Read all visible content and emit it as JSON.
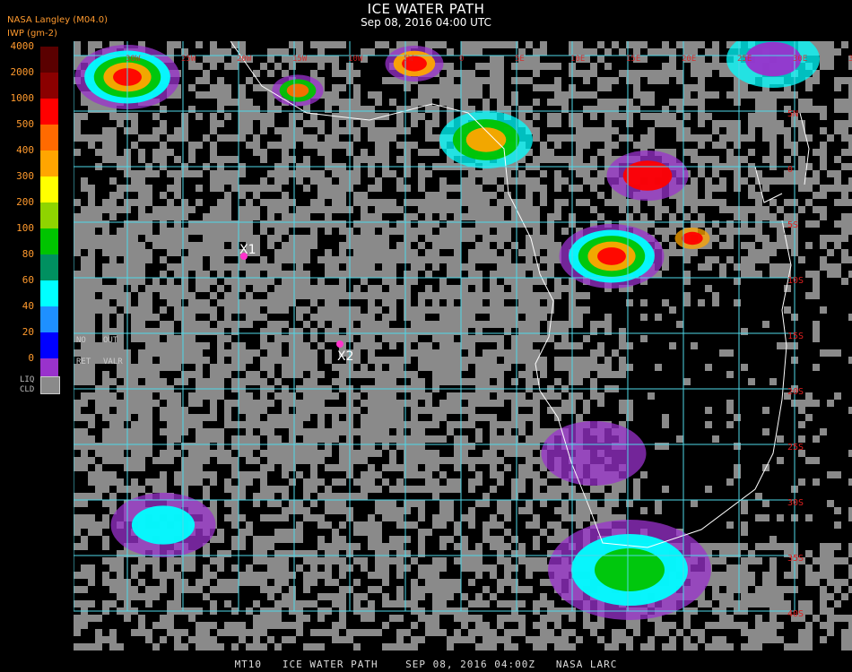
{
  "title": "ICE WATER PATH",
  "subtitle": "Sep 08, 2016 04:00 UTC",
  "header_source": "NASA Langley (M04.0)",
  "header_unit": "IWP (gm-2)",
  "legend": {
    "labels": [
      "4000",
      "2000",
      "1000",
      "500",
      "400",
      "300",
      "200",
      "100",
      "80",
      "60",
      "40",
      "20",
      "0"
    ],
    "colors": [
      "#5a0000",
      "#8b0000",
      "#ff0000",
      "#ff6a00",
      "#ffa500",
      "#ffff00",
      "#8fd400",
      "#00c400",
      "#009060",
      "#00ffff",
      "#1e90ff",
      "#0000ff",
      "#9932cc"
    ],
    "liquid_label_1": "LIQ",
    "liquid_label_2": "CLD",
    "liquid_color": "#8a8a8a",
    "no_retrieval_1": "NO",
    "no_retrieval_2": "OUT",
    "no_retrieval_3": "RET",
    "no_retrieval_4": "VALR"
  },
  "map": {
    "grid_color": "#4fd8e8",
    "coast_color": "#ffffff",
    "lat_labels": [
      "5N",
      "0",
      "5S",
      "10S",
      "15S",
      "20S",
      "25S",
      "30S",
      "35S",
      "40S"
    ],
    "lon_labels": [
      "30W",
      "25W",
      "20W",
      "15W",
      "10W",
      "5W",
      "0",
      "5E",
      "10E",
      "15E",
      "20E",
      "25E",
      "30E",
      "35E"
    ],
    "lat_label_color": "#e02020",
    "markers": [
      {
        "label": "X1",
        "color": "#ff33cc"
      },
      {
        "label": "X2",
        "color": "#ff33cc"
      }
    ]
  },
  "footer": "MT10   ICE WATER PATH    SEP 08, 2016 04:00Z   NASA LARC"
}
